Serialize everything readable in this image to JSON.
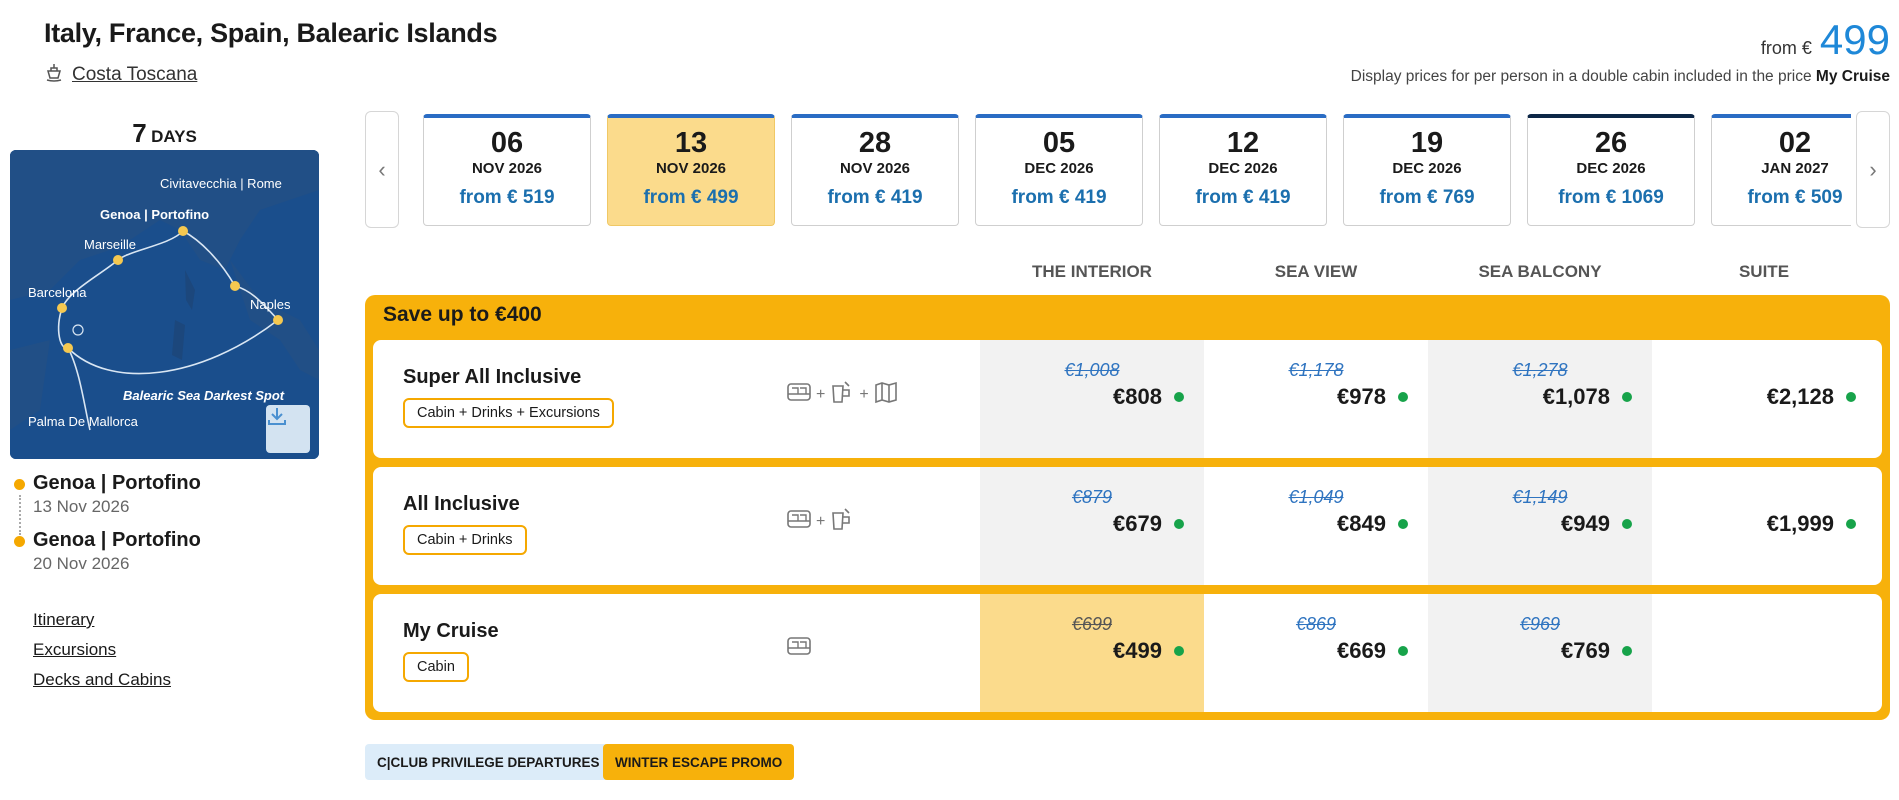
{
  "header": {
    "title": "Italy, France, Spain, Balearic Islands",
    "ship": "Costa Toscana",
    "from_label": "from €",
    "from_price": "499",
    "price_note_prefix": "Display prices for per person in a double cabin included in the price",
    "price_note_bold": "My Cruise"
  },
  "duration": {
    "number": "7",
    "label": "DAYS"
  },
  "map": {
    "labels": [
      "Civitavecchia | Rome",
      "Genoa | Portofino",
      "Marseille",
      "Barcelona",
      "Naples",
      "Balearic Sea Darkest Spot",
      "Palma De Mallorca"
    ],
    "download_icon": "download-icon"
  },
  "ports": [
    {
      "name": "Genoa | Portofino",
      "date": "13 Nov 2026"
    },
    {
      "name": "Genoa | Portofino",
      "date": "20 Nov 2026"
    }
  ],
  "links": [
    "Itinerary",
    "Excursions",
    "Decks and Cabins"
  ],
  "dates": [
    {
      "day": "06",
      "month": "NOV 2026",
      "price": "from € 519",
      "selected": false
    },
    {
      "day": "13",
      "month": "NOV 2026",
      "price": "from € 499",
      "selected": true
    },
    {
      "day": "28",
      "month": "NOV 2026",
      "price": "from € 419",
      "selected": false
    },
    {
      "day": "05",
      "month": "DEC 2026",
      "price": "from € 419",
      "selected": false
    },
    {
      "day": "12",
      "month": "DEC 2026",
      "price": "from € 419",
      "selected": false
    },
    {
      "day": "19",
      "month": "DEC 2026",
      "price": "from € 769",
      "selected": false
    },
    {
      "day": "26",
      "month": "DEC 2026",
      "price": "from € 1069",
      "selected": false
    },
    {
      "day": "02",
      "month": "JAN 2027",
      "price": "from € 509",
      "selected": false
    }
  ],
  "nav": {
    "prev": "‹",
    "next": "›"
  },
  "cabin_headers": [
    "THE INTERIOR",
    "SEA VIEW",
    "SEA BALCONY",
    "SUITE"
  ],
  "promo": {
    "title": "Save up to €400"
  },
  "packages": [
    {
      "name": "Super All Inclusive",
      "tag": "Cabin + Drinks + Excursions",
      "icons": [
        "bed-icon",
        "drink-icon",
        "map-icon"
      ],
      "prices": [
        {
          "old": "€1,008",
          "new": "€808"
        },
        {
          "old": "€1,178",
          "new": "€978"
        },
        {
          "old": "€1,278",
          "new": "€1,078"
        },
        {
          "old": "",
          "new": "€2,128"
        }
      ]
    },
    {
      "name": "All Inclusive",
      "tag": "Cabin + Drinks",
      "icons": [
        "bed-icon",
        "drink-icon"
      ],
      "prices": [
        {
          "old": "€879",
          "new": "€679"
        },
        {
          "old": "€1,049",
          "new": "€849"
        },
        {
          "old": "€1,149",
          "new": "€949"
        },
        {
          "old": "",
          "new": "€1,999"
        }
      ]
    },
    {
      "name": "My Cruise",
      "tag": "Cabin",
      "icons": [
        "bed-icon"
      ],
      "prices": [
        {
          "old": "€699",
          "new": "€499"
        },
        {
          "old": "€869",
          "new": "€669"
        },
        {
          "old": "€969",
          "new": "€769"
        },
        {
          "old": "",
          "new": ""
        }
      ]
    }
  ],
  "badges": [
    "C|CLUB PRIVILEGE DEPARTURES",
    "WINTER ESCAPE PROMO"
  ],
  "colors": {
    "accent": "#f7b10b",
    "price_blue": "#1b6fae",
    "headline_blue": "#1e88d8",
    "available": "#17a34a"
  }
}
